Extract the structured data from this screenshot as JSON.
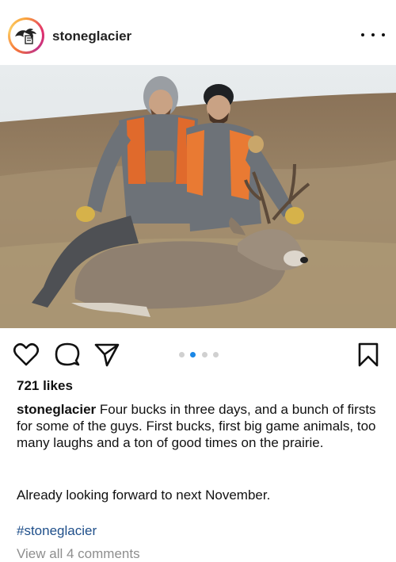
{
  "post": {
    "username": "stoneglacier",
    "likes": "721 likes",
    "caption_user": "stoneglacier",
    "caption_text": " Four bucks in three days, and a bunch of firsts for some of the guys. First bucks, first big game animals, too many laughs and a ton of good times on the prairie.",
    "caption_text_2": "Already looking forward to next November.",
    "hashtag": "#stoneglacier",
    "view_comments": "View all 4 comments"
  },
  "carousel": {
    "total": 4,
    "active_index": 1
  },
  "icons": {
    "more": "more-horizontal-icon",
    "like": "heart-icon",
    "comment": "comment-icon",
    "share": "send-icon",
    "save": "bookmark-icon"
  },
  "colors": {
    "active_dot": "#1a87e6",
    "hashtag": "#1f4f8a",
    "muted": "#8e8e8e"
  }
}
